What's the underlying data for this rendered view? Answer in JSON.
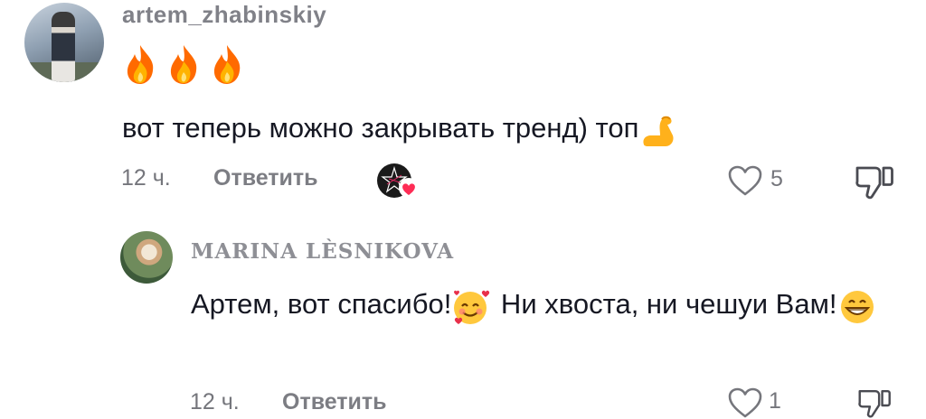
{
  "comment": {
    "username": "artem_zhabinskiy",
    "emoji_line": [
      "fire-emoji",
      "fire-emoji",
      "fire-emoji"
    ],
    "text": "вот теперь можно закрывать тренд) топ",
    "text_emoji": "flexed-biceps-emoji",
    "time": "12 ч.",
    "reply_label": "Ответить",
    "badge": "creator-liked-badge",
    "likes": "5"
  },
  "reply": {
    "username": "MARINA LÈSNIKOVA",
    "text_part1": "Артем, вот спасибо!",
    "text_emoji1": "smiling-face-with-hearts-emoji",
    "text_part2": " Ни хвоста, ни чешуи Вам!",
    "text_emoji2": "grinning-face-emoji",
    "time": "12 ч.",
    "reply_label": "Ответить",
    "likes": "1"
  },
  "colors": {
    "text": "#161823",
    "muted": "#75767c",
    "heart_badge": "#fe2c55",
    "fire": "#ff7a00"
  }
}
